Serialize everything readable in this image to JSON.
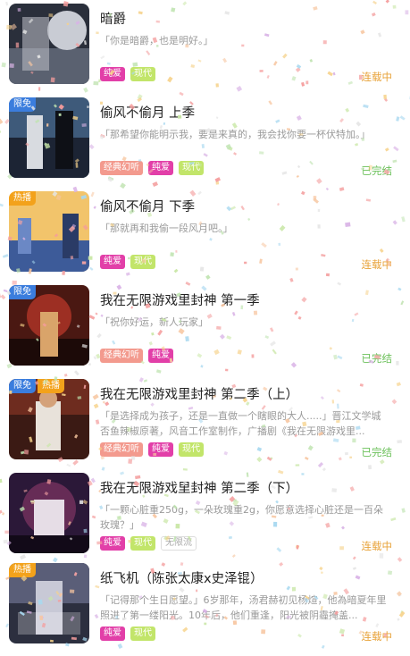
{
  "colors": {
    "tag_pink": "#e23fa8",
    "tag_lime": "#c2e56a",
    "tag_salmon": "#f39a8e",
    "status_ongoing": "#e8a33a",
    "status_done": "#6cc15b",
    "badge_limited": "#3b7ddd",
    "badge_hot": "#f3a21b"
  },
  "items": [
    {
      "title": "暗爵",
      "desc": "「你是暗爵，也是明好。」",
      "badges": [],
      "tags": [
        {
          "label": "纯爱",
          "style": "pink"
        },
        {
          "label": "现代",
          "style": "lime"
        }
      ],
      "status": "连载中",
      "status_style": "ongoing"
    },
    {
      "title": "偷风不偷月 上季",
      "desc": "「那希望你能明示我，要是来真的，我会找你要一杯伏特加。」",
      "badges": [
        {
          "label": "限免",
          "style": "limited"
        }
      ],
      "tags": [
        {
          "label": "经典幻听",
          "style": "salmon"
        },
        {
          "label": "纯爱",
          "style": "pink"
        },
        {
          "label": "现代",
          "style": "lime"
        }
      ],
      "status": "已完结",
      "status_style": "done"
    },
    {
      "title": "偷风不偷月 下季",
      "desc": "「那就再和我偷一段风月吧。」",
      "badges": [
        {
          "label": "热播",
          "style": "hot"
        }
      ],
      "tags": [
        {
          "label": "纯爱",
          "style": "pink"
        },
        {
          "label": "现代",
          "style": "lime"
        }
      ],
      "status": "连载中",
      "status_style": "ongoing"
    },
    {
      "title": "我在无限游戏里封神 第一季",
      "desc": "「祝你好运，新人玩家」",
      "badges": [
        {
          "label": "限免",
          "style": "limited"
        }
      ],
      "tags": [
        {
          "label": "经典幻听",
          "style": "salmon"
        },
        {
          "label": "纯爱",
          "style": "pink"
        }
      ],
      "status": "已完结",
      "status_style": "done"
    },
    {
      "title": "我在无限游戏里封神 第二季（上）",
      "desc": "「是选择成为孩子，还是一直做一个瞎眼的大人.....」晋江文学城否鱼辣椒原著，风音工作室制作，广播剧《我在无限游戏里...",
      "badges": [
        {
          "label": "限免",
          "style": "limited"
        },
        {
          "label": "热播",
          "style": "hot"
        }
      ],
      "tags": [
        {
          "label": "经典幻听",
          "style": "salmon"
        },
        {
          "label": "纯爱",
          "style": "pink"
        },
        {
          "label": "现代",
          "style": "lime"
        }
      ],
      "status": "已完结",
      "status_style": "done"
    },
    {
      "title": "我在无限游戏里封神 第二季（下）",
      "desc": "「一颗心脏重250g，一朵玫瑰重2g，你愿意选择心脏还是一百朵玫瑰？」",
      "badges": [],
      "tags": [
        {
          "label": "纯爱",
          "style": "pink"
        },
        {
          "label": "现代",
          "style": "lime"
        },
        {
          "label": "无限流",
          "style": "grey"
        }
      ],
      "status": "连载中",
      "status_style": "ongoing"
    },
    {
      "title": "纸飞机（陈张太康x史泽锟）",
      "desc": "「记得那个生日愿望。」6岁那年，汤君赫初见杨煊，他為暗夏年里照进了第一缕阳光。10年后，他们重逢，阳光被阴霾掩盖...",
      "badges": [
        {
          "label": "热播",
          "style": "hot"
        }
      ],
      "tags": [
        {
          "label": "纯爱",
          "style": "pink"
        },
        {
          "label": "现代",
          "style": "lime"
        }
      ],
      "status": "连载中",
      "status_style": "ongoing"
    }
  ]
}
